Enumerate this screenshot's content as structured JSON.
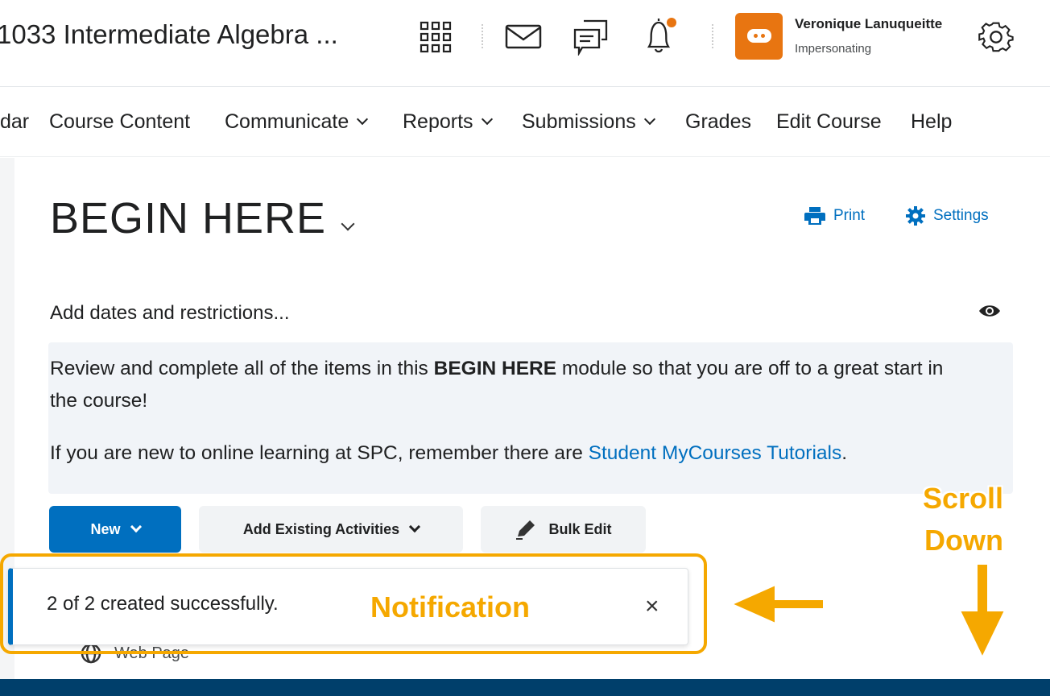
{
  "header": {
    "course_title": "1033 Intermediate Algebra ...",
    "user_name": "Veronique Lanuqueitte",
    "user_role": "Impersonating",
    "notification_dot_color": "#e87511"
  },
  "nav": {
    "items": [
      {
        "label": "dar",
        "dropdown": false
      },
      {
        "label": "Course Content",
        "dropdown": false
      },
      {
        "label": "Communicate",
        "dropdown": true
      },
      {
        "label": "Reports",
        "dropdown": true
      },
      {
        "label": "Submissions",
        "dropdown": true
      },
      {
        "label": "Grades",
        "dropdown": false
      },
      {
        "label": "Edit Course",
        "dropdown": false
      },
      {
        "label": "Help",
        "dropdown": false
      }
    ]
  },
  "module": {
    "title": "BEGIN HERE",
    "print_label": "Print",
    "settings_label": "Settings",
    "dates_label": "Add dates and restrictions...",
    "desc1_pre": "Review and complete all of the items in this ",
    "desc1_bold": "BEGIN HERE",
    "desc1_post": " module so that you are off to a great start in the course!",
    "desc2_pre": "If you are new to online learning at SPC, remember there are ",
    "desc2_link": "Student MyCourses Tutorials",
    "desc2_post": ".",
    "buttons": {
      "new": "New",
      "add_existing": "Add Existing Activities",
      "bulk_edit": "Bulk Edit"
    },
    "item_partial": "Web Page"
  },
  "toast": {
    "message": "2 of 2 created successfully.",
    "close": "×"
  },
  "annotations": {
    "notification": "Notification",
    "scroll1": "Scroll",
    "scroll2": "Down",
    "color": "#f5a800"
  }
}
